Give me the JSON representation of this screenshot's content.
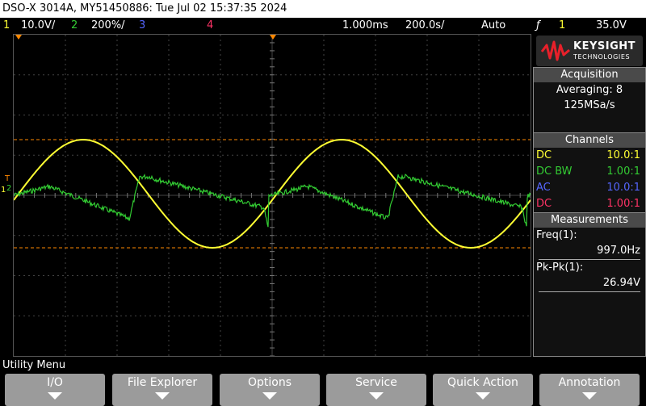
{
  "title_bar": "DSO-X 3014A, MY51450886: Tue Jul 02 15:37:35 2024",
  "status": {
    "ch1_num": "1",
    "ch1_scale": "10.0V/",
    "ch2_num": "2",
    "ch2_scale": "200%/",
    "ch3_num": "3",
    "ch4_num": "4",
    "timebase": "1.000ms",
    "horizontal": "200.0s/",
    "trigger_mode": "Auto",
    "trigger_icon": "ƒ",
    "trigger_source": "1",
    "trigger_level": "35.0V"
  },
  "logo": {
    "brand": "KEYSIGHT",
    "sub": "TECHNOLOGIES"
  },
  "acquisition": {
    "header": "Acquisition",
    "mode": "Averaging: 8",
    "rate": "125MSa/s"
  },
  "channels": {
    "header": "Channels",
    "rows": [
      {
        "coupling": "DC",
        "probe": "10.0:1",
        "color": "#ffff33"
      },
      {
        "coupling": "DC BW",
        "probe": "1.00:1",
        "color": "#33cc33"
      },
      {
        "coupling": "AC",
        "probe": "10.0:1",
        "color": "#5566ff"
      },
      {
        "coupling": "DC",
        "probe": "1.00:1",
        "color": "#ff3366"
      }
    ]
  },
  "measurements": {
    "header": "Measurements",
    "freq_label": "Freq(1):",
    "freq_value": "997.0Hz",
    "pkpk_label": "Pk-Pk(1):",
    "pkpk_value": "26.94V"
  },
  "utility_menu": "Utility Menu",
  "softkeys": [
    "I/O",
    "File Explorer",
    "Options",
    "Service",
    "Quick Action",
    "Annotation"
  ],
  "markers": {
    "trigger": "T",
    "ch2": "2",
    "ch1": "1"
  },
  "colors": {
    "ch1": "#ffff33",
    "ch2": "#33cc33",
    "ch3": "#5566ff",
    "ch4": "#ff3366",
    "cursor": "#ff8800",
    "grid": "#444444",
    "panel_header": "#4a4a4a"
  }
}
